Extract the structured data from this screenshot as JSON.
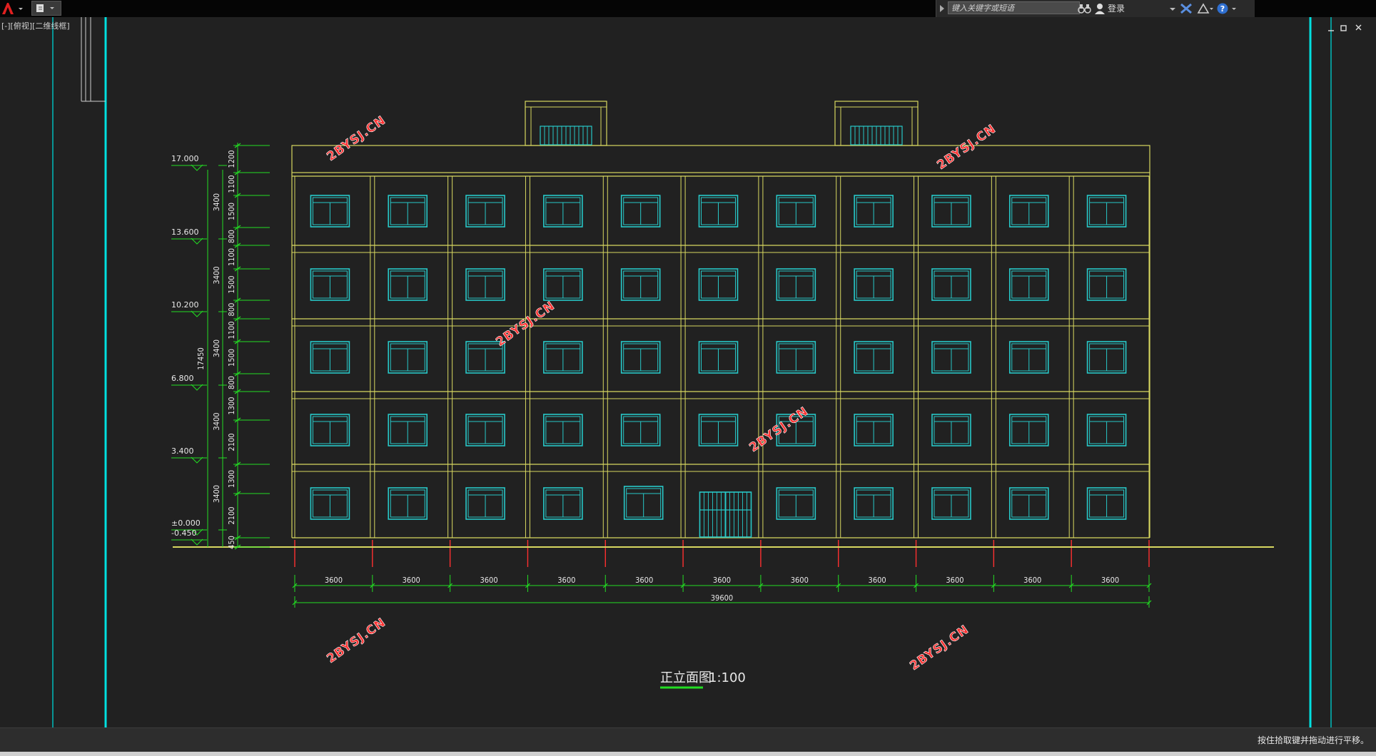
{
  "toolbar": {
    "search_placeholder": "键入关键字或短语",
    "login_label": "登录"
  },
  "viewport": {
    "label": "[-][俯视][二维线框]"
  },
  "drawing": {
    "title": "正立面图",
    "scale": "1:100",
    "watermarks": [
      "2BYSJ.CN",
      "2BYSJ.CN",
      "2BYSJ.CN",
      "2BYSJ.CN",
      "2BYSJ.CN",
      "2BYSJ.CN"
    ],
    "levels": [
      "17.000",
      "13.600",
      "10.200",
      "6.800",
      "3.400",
      "±0.000",
      "-0.450"
    ],
    "vertical_total": "17450",
    "floor_heights": [
      "3400",
      "3400",
      "3400",
      "3400",
      "3400"
    ],
    "segment_dims": [
      "1200",
      "1100",
      "1500",
      "800",
      "1100",
      "1500",
      "800",
      "1100",
      "1500",
      "800",
      "1300",
      "2100",
      "1300",
      "2100",
      "450"
    ],
    "bay_dims": [
      "3600",
      "3600",
      "3600",
      "3600",
      "3600",
      "3600",
      "3600",
      "3600",
      "3600",
      "3600",
      "3600"
    ],
    "total_width": "39600"
  },
  "status": {
    "message": "按住拾取键并拖动进行平移。"
  },
  "colors": {
    "facade": "#d8d860",
    "window": "#27c8c8",
    "dimension": "#22dd22",
    "marker": "#ff3030",
    "border": "#00cccc"
  }
}
